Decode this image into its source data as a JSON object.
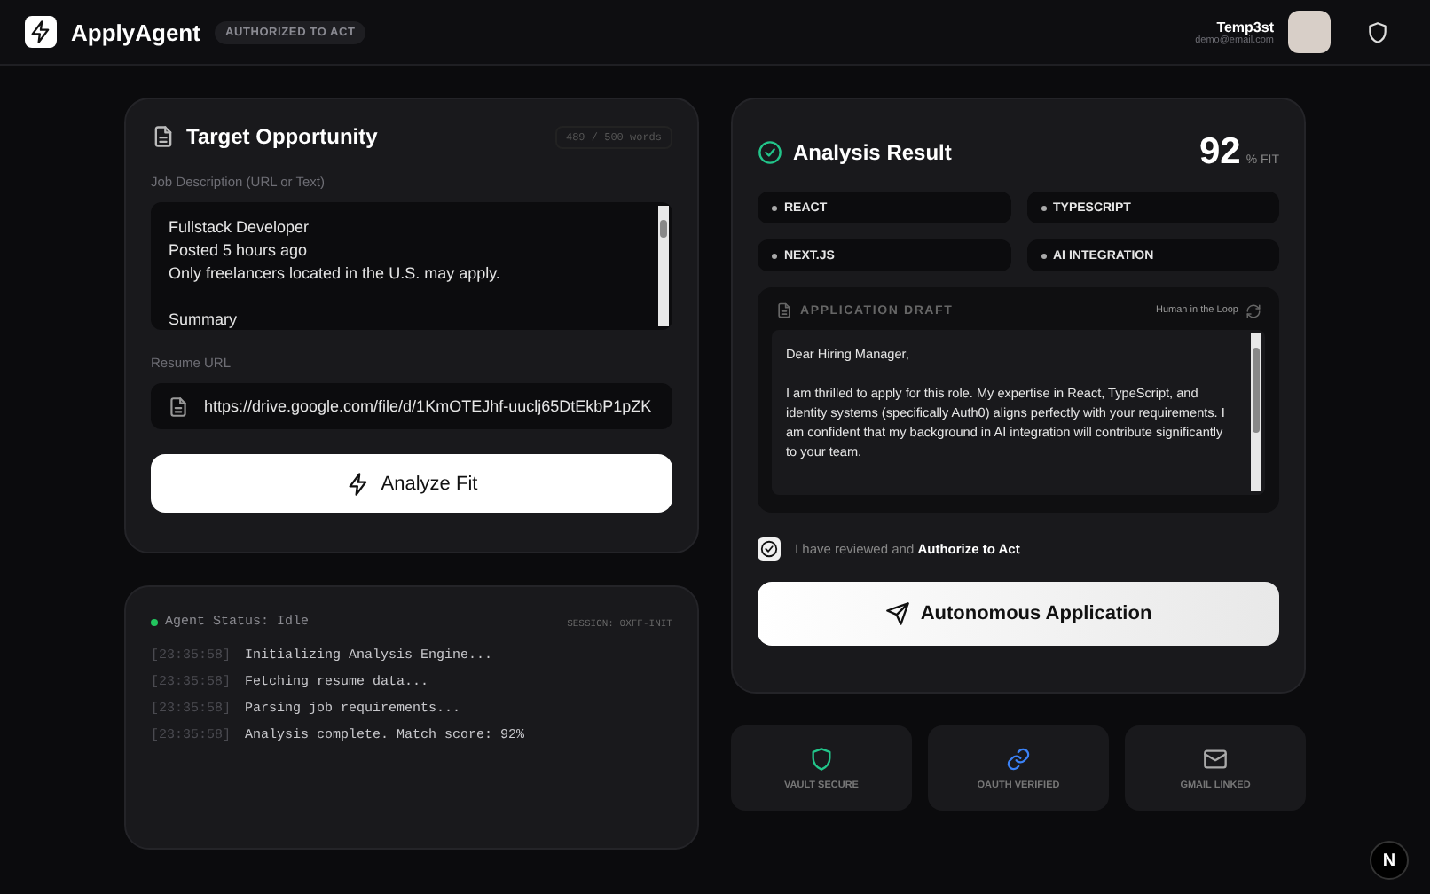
{
  "header": {
    "app_name": "ApplyAgent",
    "badge": "AUTHORIZED TO ACT",
    "user_name": "Temp3st",
    "user_email": "demo@email.com"
  },
  "target": {
    "title": "Target Opportunity",
    "word_count": "489 / 500 words",
    "job_label": "Job Description (URL or Text)",
    "job_description": "Fullstack Developer\nPosted 5 hours ago\nOnly freelancers located in the U.S. may apply.\n\nSummary",
    "resume_label": "Resume URL",
    "resume_url": "https://drive.google.com/file/d/1KmOTEJhf-uuclj65DtEkbP1pZK",
    "analyze_button": "Analyze Fit"
  },
  "agent_log": {
    "status": "Agent Status: Idle",
    "session": "SESSION: 0XFF-INIT",
    "entries": [
      {
        "time": "[23:35:58]",
        "message": "Initializing Analysis Engine..."
      },
      {
        "time": "[23:35:58]",
        "message": "Fetching resume data..."
      },
      {
        "time": "[23:35:58]",
        "message": "Parsing job requirements..."
      },
      {
        "time": "[23:35:58]",
        "message": "Analysis complete. Match score: 92%"
      }
    ]
  },
  "analysis": {
    "title": "Analysis Result",
    "score": "92",
    "score_unit": "% FIT",
    "skills": [
      "REACT",
      "TYPESCRIPT",
      "NEXT.JS",
      "AI INTEGRATION"
    ],
    "draft": {
      "title": "APPLICATION DRAFT",
      "mode": "Human in the Loop",
      "text": "Dear Hiring Manager,\n\nI am thrilled to apply for this role. My expertise in React, TypeScript, and identity systems (specifically Auth0) aligns perfectly with your requirements. I am confident that my background in AI integration will contribute significantly to your team."
    },
    "authorize": {
      "checked": true,
      "text": "I have reviewed and **Authorize to Act**"
    },
    "submit_button": "Autonomous Application"
  },
  "integrations": [
    {
      "kind": "shield",
      "label": "VAULT SECURE"
    },
    {
      "kind": "link",
      "label": "OAUTH VERIFIED"
    },
    {
      "kind": "mail",
      "label": "GMAIL LINKED"
    }
  ],
  "dev_indicator": "N"
}
